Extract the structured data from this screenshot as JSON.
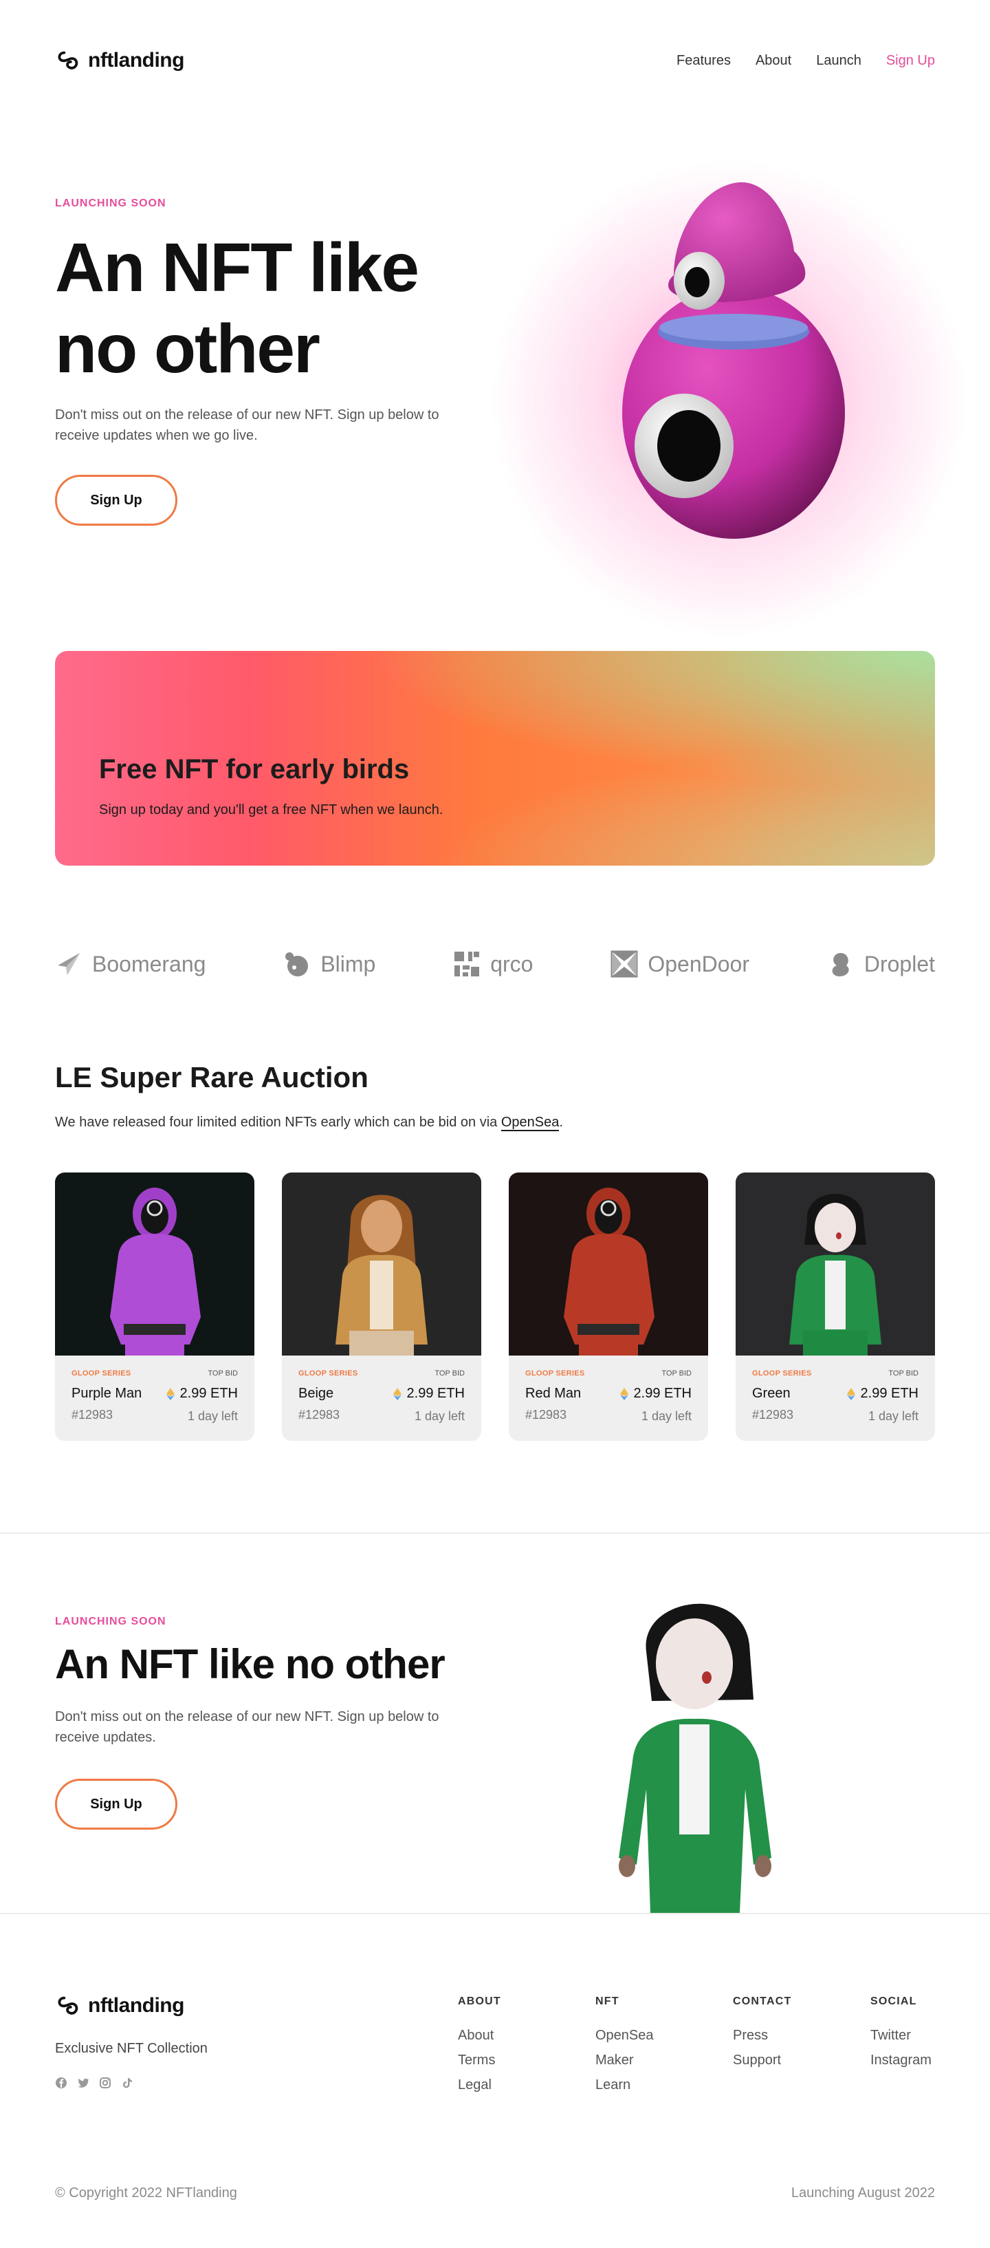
{
  "nav": {
    "brand": "nftlanding",
    "links": [
      "Features",
      "About",
      "Launch"
    ],
    "signup": "Sign Up"
  },
  "hero": {
    "eyebrow": "LAUNCHING SOON",
    "title": "An NFT like no other",
    "description": "Don't miss out on the release of our new NFT. Sign up below to receive updates when we go live.",
    "button": "Sign Up"
  },
  "promo": {
    "title": "Free NFT for early birds",
    "description": "Sign up today and you'll get a free NFT when we launch."
  },
  "partners": [
    {
      "name": "Boomerang",
      "icon": "boomerang-icon"
    },
    {
      "name": "Blimp",
      "icon": "blimp-icon"
    },
    {
      "name": "qrco",
      "icon": "qrco-icon"
    },
    {
      "name": "OpenDoor",
      "icon": "opendoor-icon"
    },
    {
      "name": "Droplet",
      "icon": "droplet-icon"
    }
  ],
  "auction": {
    "title": "LE Super Rare Auction",
    "description_before": "We have released four limited edition NFTs early which can be bid on via ",
    "link": "OpenSea",
    "description_after": ".",
    "cards": [
      {
        "series": "GLOOP SERIES",
        "label": "TOP BID",
        "name": "Purple Man",
        "price": "2.99 ETH",
        "id": "#12983",
        "time": "1 day left",
        "bg": "#0f1716",
        "color": "#b04dd6"
      },
      {
        "series": "GLOOP SERIES",
        "label": "TOP BID",
        "name": "Beige",
        "price": "2.99 ETH",
        "id": "#12983",
        "time": "1 day left",
        "bg": "#262626",
        "color": "#c9934c"
      },
      {
        "series": "GLOOP SERIES",
        "label": "TOP BID",
        "name": "Red Man",
        "price": "2.99 ETH",
        "id": "#12983",
        "time": "1 day left",
        "bg": "#1c1312",
        "color": "#b83a26"
      },
      {
        "series": "GLOOP SERIES",
        "label": "TOP BID",
        "name": "Green",
        "price": "2.99 ETH",
        "id": "#12983",
        "time": "1 day left",
        "bg": "#2a2a2c",
        "color": "#239148"
      }
    ]
  },
  "cta": {
    "eyebrow": "LAUNCHING SOON",
    "title": "An NFT like no other",
    "description": "Don't miss out on the release of our new NFT. Sign up below to receive updates.",
    "button": "Sign Up"
  },
  "footer": {
    "brand": "nftlanding",
    "tagline": "Exclusive NFT Collection",
    "social_icons": [
      "facebook-icon",
      "twitter-icon",
      "instagram-icon",
      "tiktok-icon"
    ],
    "columns": [
      {
        "heading": "ABOUT",
        "links": [
          "About",
          "Terms",
          "Legal"
        ]
      },
      {
        "heading": "NFT",
        "links": [
          "OpenSea",
          "Maker",
          "Learn"
        ]
      },
      {
        "heading": "CONTACT",
        "links": [
          "Press",
          "Support"
        ]
      },
      {
        "heading": "SOCIAL",
        "links": [
          "Twitter",
          "Instagram"
        ]
      }
    ],
    "copyright": "© Copyright 2022 NFTlanding",
    "launch": "Launching August 2022"
  },
  "colors": {
    "accent_pink": "#e64d9b",
    "accent_orange": "#ef7a45"
  }
}
